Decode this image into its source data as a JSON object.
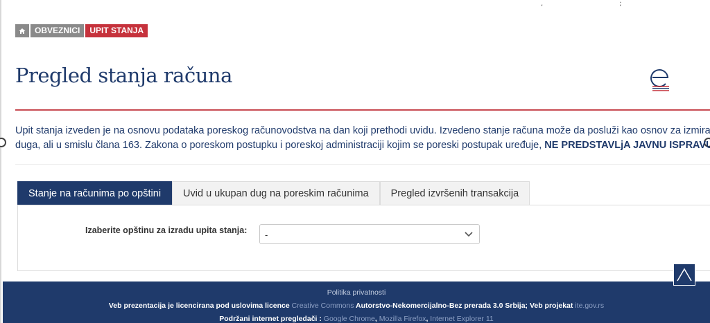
{
  "breadcrumb": {
    "home_icon": "home-icon",
    "items": [
      "OBVEZNICI",
      "UPIT STANJA"
    ]
  },
  "page": {
    "title": "Pregled stanja računa"
  },
  "notice": {
    "line1": "Upit stanja izveden je na osnovu podataka poreskog računovodstva na dan koji prethodi uvidu. Izvedeno stanje računa može da posluži kao osnov za izmira",
    "line2": "duga, ali u smislu člana 163. Zakona o poreskom postupku i poreskoj administraciji kojim se poreski postupak uređuje, ",
    "emphasis": "NE PREDSTAVLjA JAVNU ISPRAVU."
  },
  "tabs": [
    {
      "label": "Stanje na računima po opštini",
      "active": true
    },
    {
      "label": "Uvid u ukupan dug na poreskim računima",
      "active": false
    },
    {
      "label": "Pregled izvršenih transakcija",
      "active": false
    }
  ],
  "form": {
    "municipality_label": "Izaberite opštinu za izradu upita stanja:",
    "municipality_value": "-"
  },
  "footer": {
    "privacy": "Politika privatnosti",
    "license_prefix": "Veb prezentacija je licencirana pod uslovima licence ",
    "license_link": "Creative Commons",
    "license_name": " Autorstvo-Nekomercijalno-Bez prerada 3.0 Srbija; Veb projekat ",
    "project_link": "ite.gov.rs",
    "browsers_prefix": "Podržani internet pregledači : ",
    "browser1": "Google Chrome",
    "sep1": ", ",
    "browser2": "Mozilla Firefox",
    "sep2": ", ",
    "browser3": "Internet Explorer 11"
  },
  "colors": {
    "primary": "#1f3a6b",
    "accent": "#c6323c",
    "muted": "#8a8a8a"
  },
  "icons": {
    "logo": "eporezi-logo-icon",
    "scroll_top": "chevron-up-icon",
    "select_arrow": "chevron-down-icon"
  }
}
